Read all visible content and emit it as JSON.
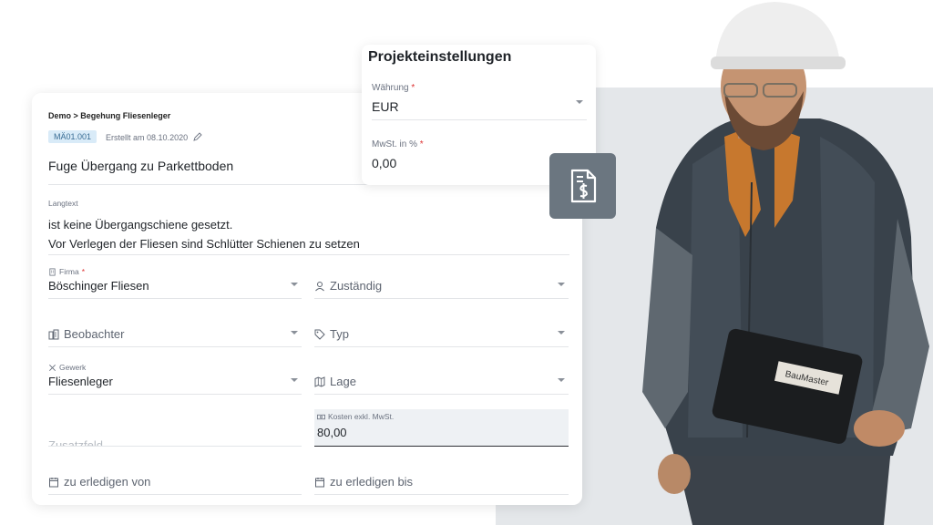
{
  "breadcrumb": "Demo > Begehung Fliesenleger",
  "issue": {
    "id_badge": "MÄ01.001",
    "created": "Erstellt am 08.10.2020",
    "title": "Fuge Übergang zu Parkettboden"
  },
  "langtext": {
    "label": "Langtext",
    "line1": "ist keine Übergangschiene gesetzt.",
    "line2": "Vor Verlegen der Fliesen sind Schlütter Schienen zu setzen"
  },
  "fields": {
    "firma": {
      "label": "Firma",
      "required": "*",
      "value": "Böschinger Fliesen"
    },
    "zustaendig": {
      "placeholder": "Zuständig"
    },
    "beobachter": {
      "placeholder": "Beobachter"
    },
    "typ": {
      "placeholder": "Typ"
    },
    "gewerk": {
      "label": "Gewerk",
      "value": "Fliesenleger"
    },
    "lage": {
      "placeholder": "Lage"
    },
    "kosten": {
      "label": "Kosten exkl. MwSt.",
      "value": "80,00"
    },
    "zusatzfeld": {
      "placeholder": "Zusatzfeld"
    },
    "erledigen_von": {
      "placeholder": "zu erledigen von"
    },
    "erledigen_bis": {
      "placeholder": "zu erledigen bis"
    }
  },
  "settings": {
    "title": "Projekteinstellungen",
    "waehrung": {
      "label": "Währung",
      "required": "*",
      "value": "EUR"
    },
    "mwst": {
      "label": "MwSt. in %",
      "required": "*",
      "value": "0,00"
    }
  },
  "icons": {
    "invoice": "invoice-dollar-icon",
    "building": "building-icon",
    "user": "user-icon",
    "observers": "buildings-icon",
    "tag": "tag-icon",
    "tools": "tools-icon",
    "map": "map-icon",
    "money": "money-icon",
    "calendar": "calendar-icon",
    "pencil": "pencil-icon"
  },
  "colors": {
    "badge_bg": "#d9ebf8",
    "badge_text": "#3a6d94",
    "required": "#dd3333",
    "invoice_button": "#6b7680",
    "background_panel": "#e4e7ea"
  },
  "photo": {
    "tablet_label": "BauMaster"
  }
}
